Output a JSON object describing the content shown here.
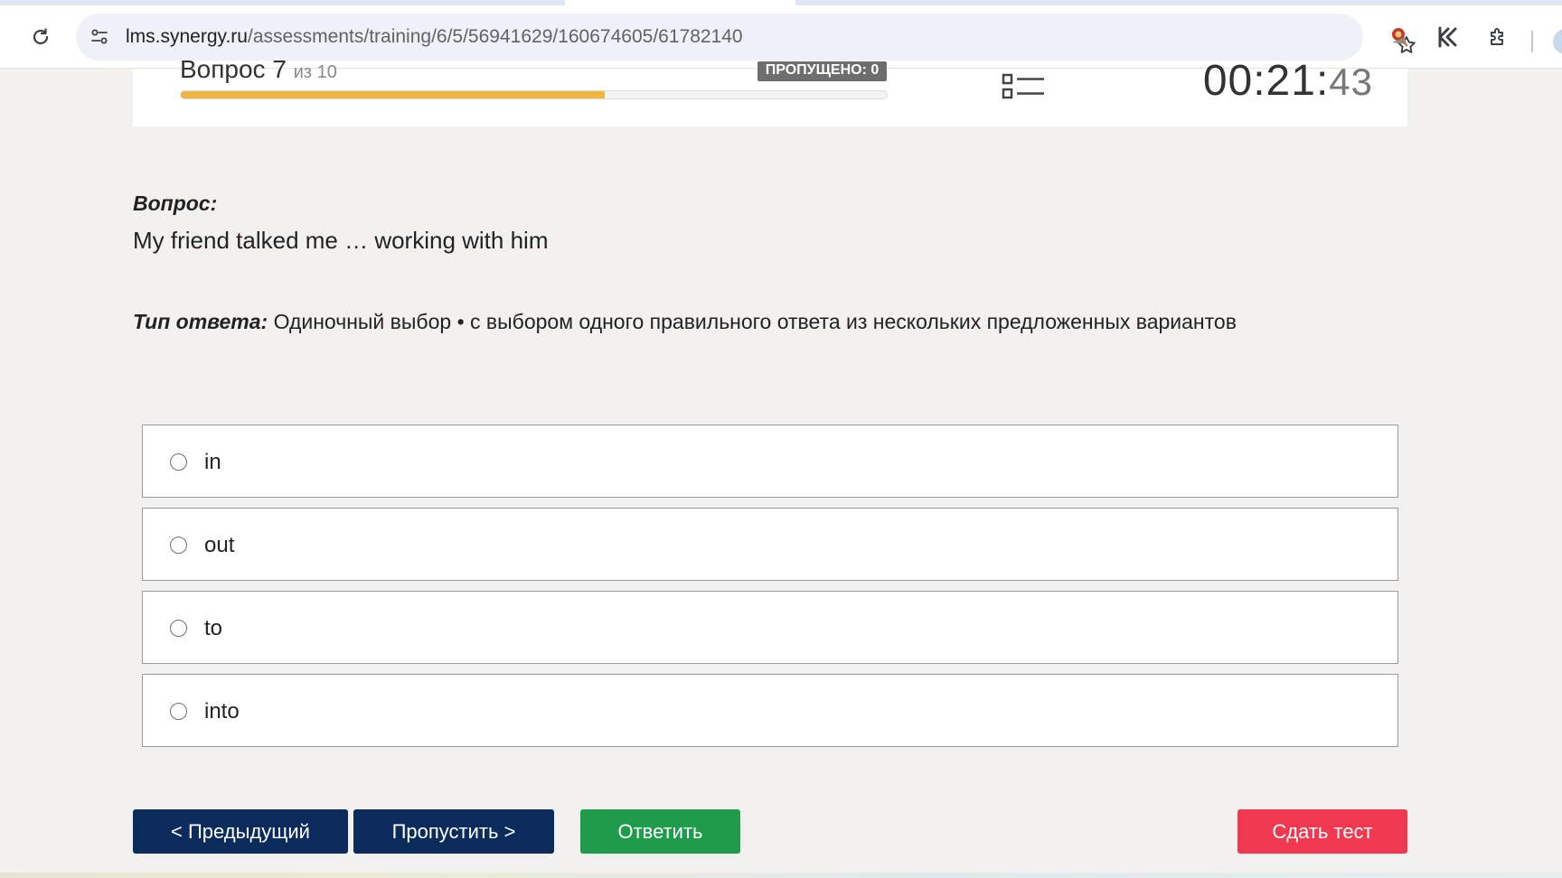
{
  "browser": {
    "url_host": "lms.synergy.ru",
    "url_path": "/assessments/training/6/5/56941629/160674605/61782140",
    "icons": {
      "reload": "reload-icon",
      "site_info": "site-info-icon",
      "bookmark": "star-icon",
      "extension_1": "extension-icon",
      "extension_2": "extension-icon",
      "extensions_menu": "puzzle-icon"
    }
  },
  "header": {
    "question_label": "Вопрос 7",
    "question_of": "из 10",
    "skipped_badge": "ПРОПУЩЕНО: 0",
    "progress_percent": 60,
    "timer_main": "00:21:",
    "timer_seconds": "43",
    "accent_color": "#f0b53c"
  },
  "question": {
    "label": "Вопрос:",
    "text": "My friend talked me … working with him",
    "answer_type_label": "Тип ответа:",
    "answer_type_value": " Одиночный выбор • с выбором одного правильного ответа из нескольких предложенных вариантов"
  },
  "options": [
    {
      "label": "in"
    },
    {
      "label": "out"
    },
    {
      "label": "to"
    },
    {
      "label": "into"
    }
  ],
  "buttons": {
    "prev": "< Предыдущий",
    "skip": "Пропустить >",
    "answer": "Ответить",
    "finish": "Сдать тест"
  },
  "colors": {
    "nav_button": "#0b2b5c",
    "answer_button": "#1e9b4b",
    "finish_button": "#f0384f"
  }
}
